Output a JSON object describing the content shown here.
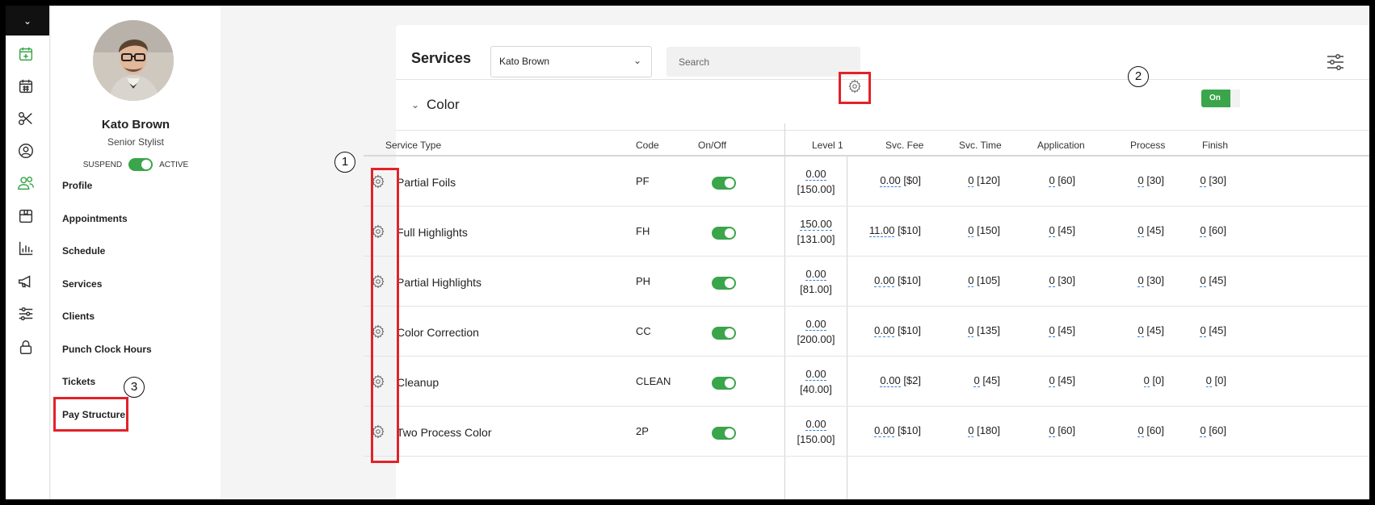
{
  "rail": {
    "icons": [
      "chevron-down-icon",
      "calendar-add-icon",
      "calendar-icon",
      "scissors-icon",
      "user-circle-icon",
      "users-icon",
      "package-icon",
      "bar-chart-icon",
      "megaphone-icon",
      "sliders-icon",
      "lock-icon"
    ]
  },
  "profile": {
    "name": "Kato Brown",
    "role": "Senior Stylist",
    "suspend_label": "SUSPEND",
    "active_label": "ACTIVE",
    "nav": [
      "Profile",
      "Appointments",
      "Schedule",
      "Services",
      "Clients",
      "Punch Clock Hours",
      "Tickets",
      "Pay Structure"
    ]
  },
  "header": {
    "title": "Services",
    "selected_stylist": "Kato Brown",
    "search_placeholder": "Search"
  },
  "group": {
    "name": "Color",
    "toggle_label": "On"
  },
  "table": {
    "columns": [
      "Service Type",
      "Code",
      "On/Off",
      "Level 1",
      "Svc. Fee",
      "Svc. Time",
      "Application",
      "Process",
      "Finish"
    ],
    "rows": [
      {
        "service": "Partial Foils",
        "code": "PF",
        "level_price": "0.00",
        "level_base": "[150.00]",
        "fee": "0.00",
        "fee_base": "[$0]",
        "time": "0",
        "time_base": "[120]",
        "app": "0",
        "app_base": "[60]",
        "proc": "0",
        "proc_base": "[30]",
        "fin": "0",
        "fin_base": "[30]"
      },
      {
        "service": "Full Highlights",
        "code": "FH",
        "level_price": "150.00",
        "level_base": "[131.00]",
        "fee": "11.00",
        "fee_base": "[$10]",
        "time": "0",
        "time_base": "[150]",
        "app": "0",
        "app_base": "[45]",
        "proc": "0",
        "proc_base": "[45]",
        "fin": "0",
        "fin_base": "[60]"
      },
      {
        "service": "Partial Highlights",
        "code": "PH",
        "level_price": "0.00",
        "level_base": "[81.00]",
        "fee": "0.00",
        "fee_base": "[$10]",
        "time": "0",
        "time_base": "[105]",
        "app": "0",
        "app_base": "[30]",
        "proc": "0",
        "proc_base": "[30]",
        "fin": "0",
        "fin_base": "[45]"
      },
      {
        "service": "Color Correction",
        "code": "CC",
        "level_price": "0.00",
        "level_base": "[200.00]",
        "fee": "0.00",
        "fee_base": "[$10]",
        "time": "0",
        "time_base": "[135]",
        "app": "0",
        "app_base": "[45]",
        "proc": "0",
        "proc_base": "[45]",
        "fin": "0",
        "fin_base": "[45]"
      },
      {
        "service": "Cleanup",
        "code": "CLEAN",
        "level_price": "0.00",
        "level_base": "[40.00]",
        "fee": "0.00",
        "fee_base": "[$2]",
        "time": "0",
        "time_base": "[45]",
        "app": "0",
        "app_base": "[45]",
        "proc": "0",
        "proc_base": "[0]",
        "fin": "0",
        "fin_base": "[0]"
      },
      {
        "service": "Two Process Color",
        "code": "2P",
        "level_price": "0.00",
        "level_base": "[150.00]",
        "fee": "0.00",
        "fee_base": "[$10]",
        "time": "0",
        "time_base": "[180]",
        "app": "0",
        "app_base": "[60]",
        "proc": "0",
        "proc_base": "[60]",
        "fin": "0",
        "fin_base": "[60]"
      }
    ]
  },
  "annotations": [
    "1",
    "2",
    "3"
  ],
  "colors": {
    "accent_green": "#3aa54a",
    "highlight_red": "#e22229",
    "dashed_link": "#3c7fd6"
  }
}
